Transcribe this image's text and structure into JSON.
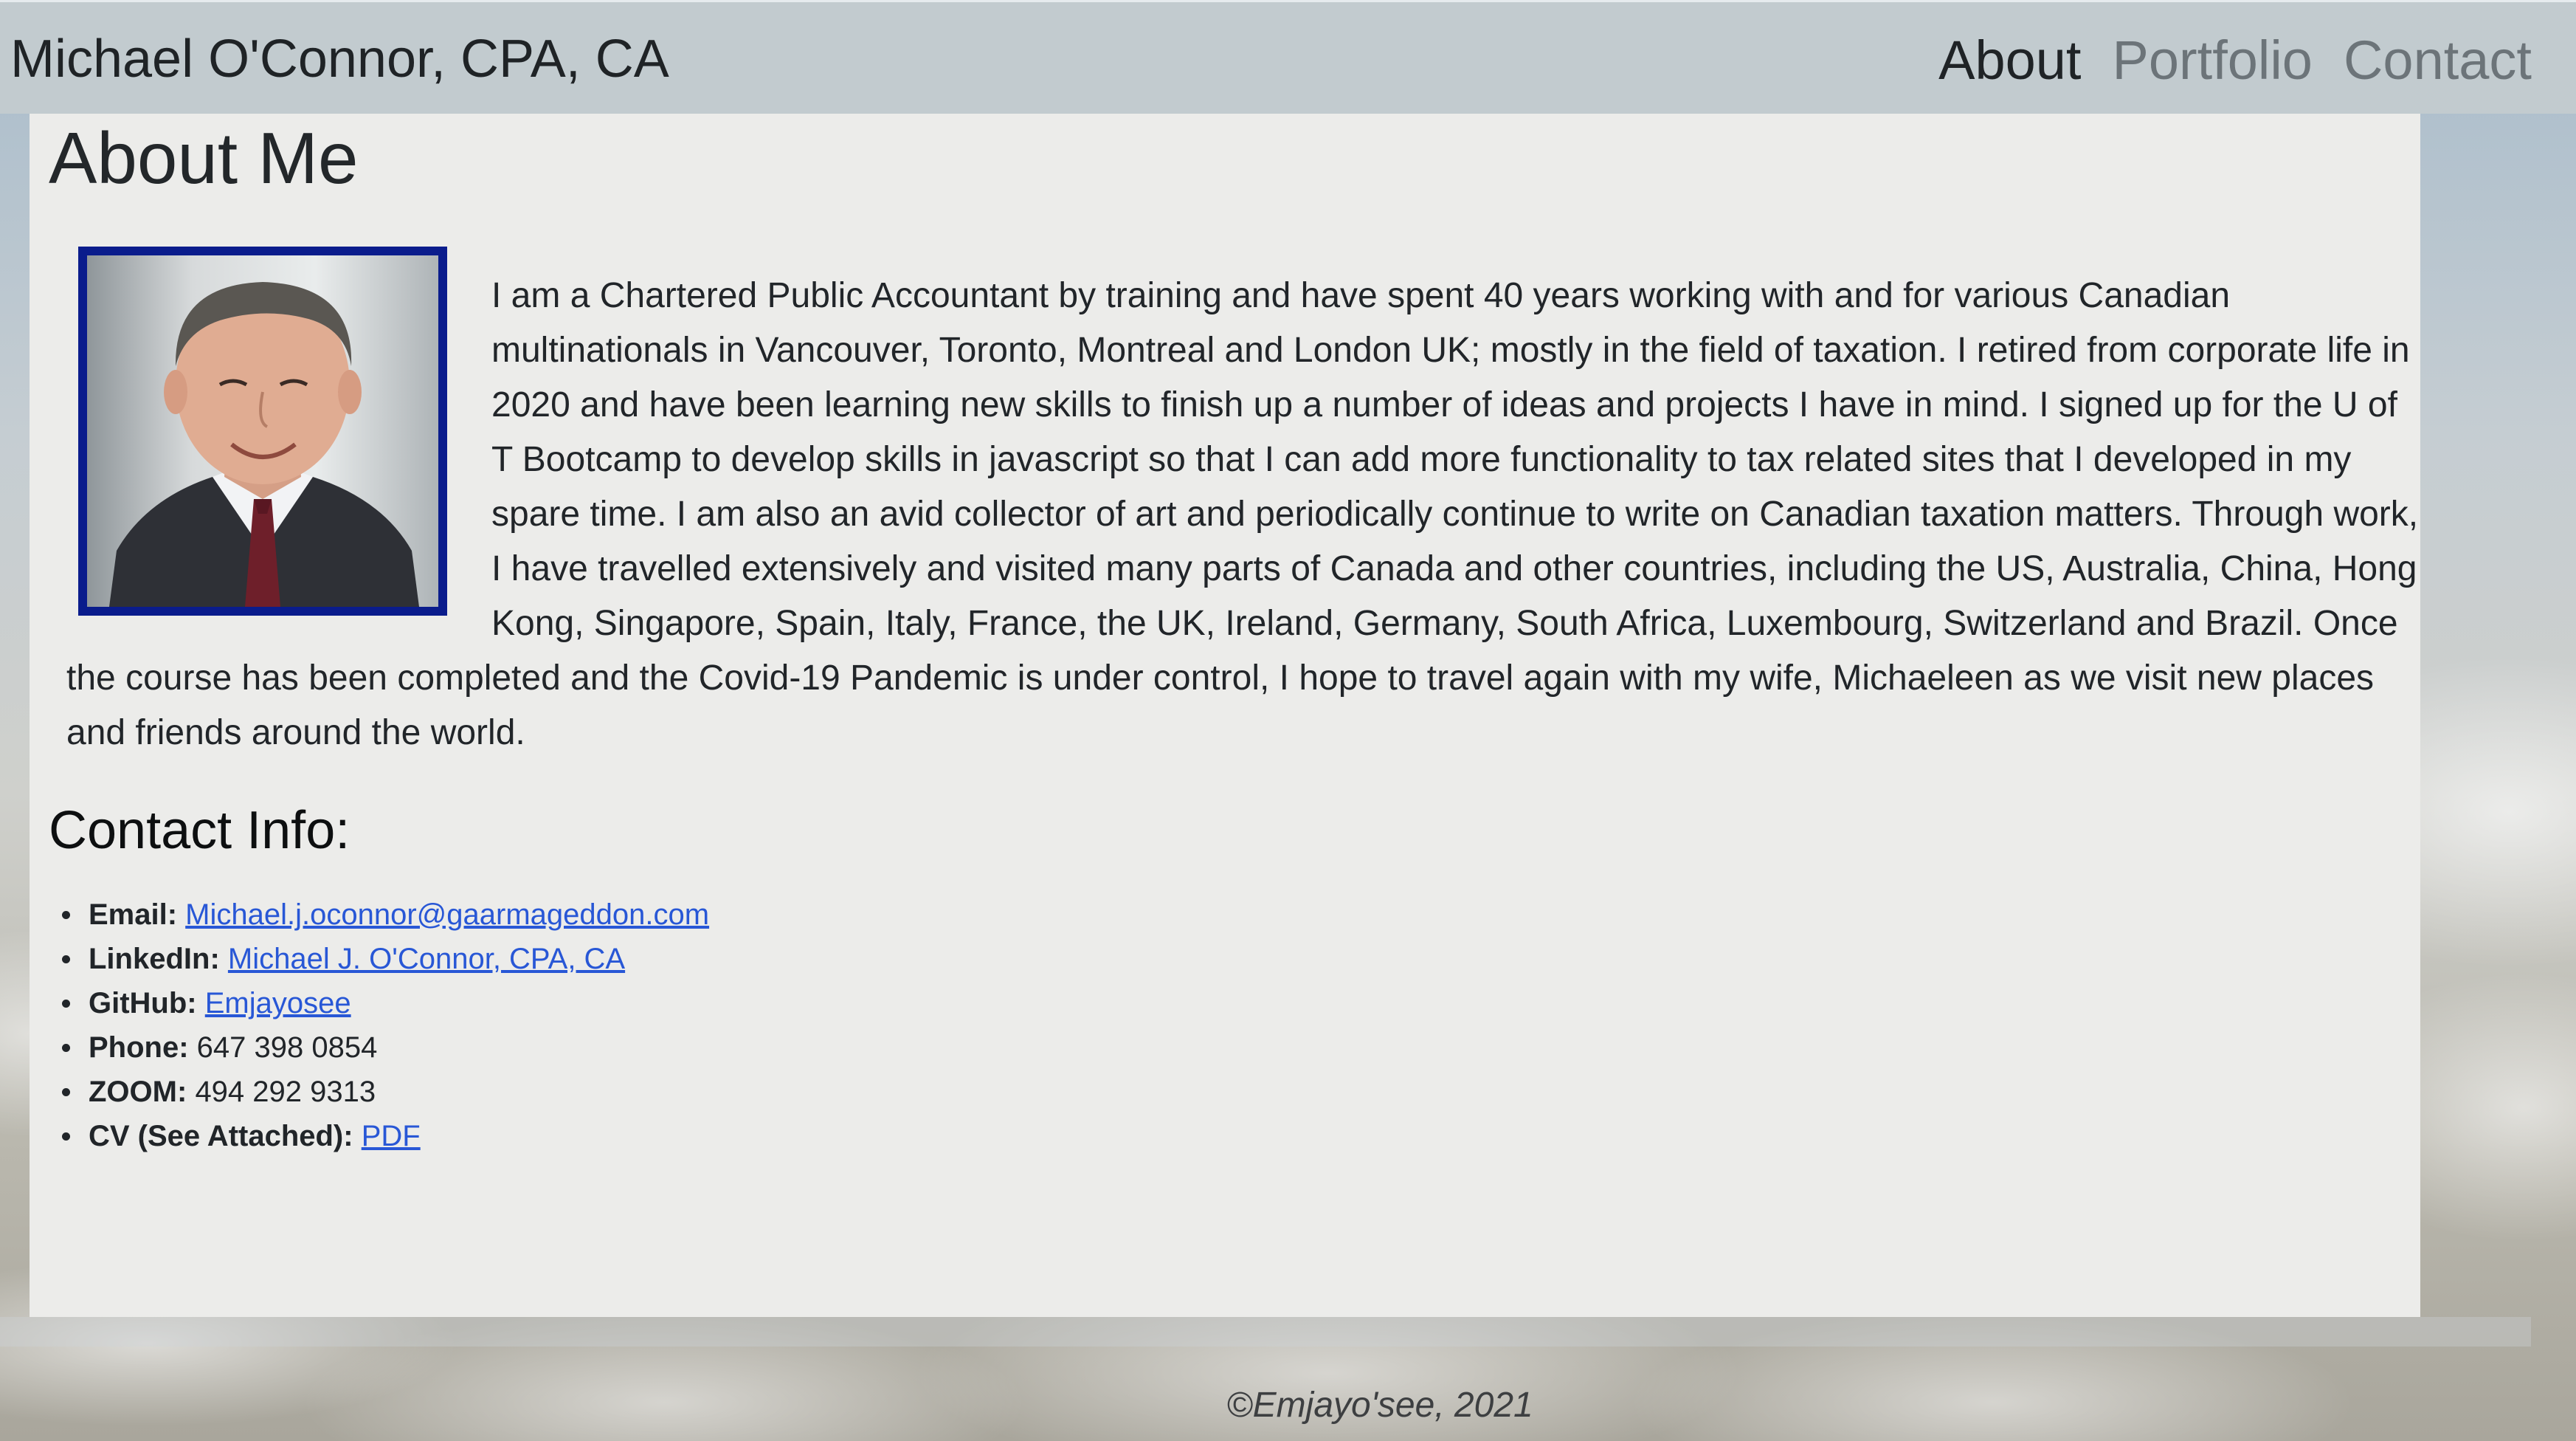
{
  "header": {
    "brand": "Michael O'Connor, CPA, CA",
    "nav": [
      {
        "label": "About",
        "active": true
      },
      {
        "label": "Portfolio",
        "active": false
      },
      {
        "label": "Contact",
        "active": false
      }
    ]
  },
  "about": {
    "title": "About Me",
    "photo_icon": "portrait-photo",
    "paragraph": "I am a Chartered Public Accountant by training and have spent 40 years working with and for various Canadian multinationals in Vancouver, Toronto, Montreal and London UK; mostly in the field of taxation. I retired from corporate life in 2020 and have been learning new skills to finish up a number of ideas and projects I have in mind. I signed up for the U of T Bootcamp to develop skills in javascript so that I can add more functionality to tax related sites that I developed in my spare time. I am also an avid collector of art and periodically continue to write on Canadian taxation matters. Through work, I have travelled extensively and visited many parts of Canada and other countries, including the US, Australia, China, Hong Kong, Singapore, Spain, Italy, France, the UK, Ireland, Germany, South Africa, Luxembourg, Switzerland and Brazil. Once the course has been completed and the Covid-19 Pandemic is under control, I hope to travel again with my wife, Michaeleen as we visit new places and friends around the world."
  },
  "contact": {
    "title": "Contact Info:",
    "items": [
      {
        "label": "Email:",
        "value": "Michael.j.oconnor@gaarmageddon.com",
        "link": true
      },
      {
        "label": "LinkedIn:",
        "value": "Michael J. O'Connor, CPA, CA",
        "link": true
      },
      {
        "label": "GitHub:",
        "value": "Emjayosee",
        "link": true
      },
      {
        "label": "Phone:",
        "value": "647 398 0854",
        "link": false
      },
      {
        "label": "ZOOM:",
        "value": "494 292 9313",
        "link": false
      },
      {
        "label": "CV (See Attached):",
        "value": "PDF",
        "link": true
      }
    ]
  },
  "footer": {
    "text": "©Emjayo'see, 2021"
  },
  "colors": {
    "header_bg": "#c2cbcf",
    "panel_bg": "#ececea",
    "link": "#2857d6",
    "photo_border": "#0a1c8c"
  }
}
